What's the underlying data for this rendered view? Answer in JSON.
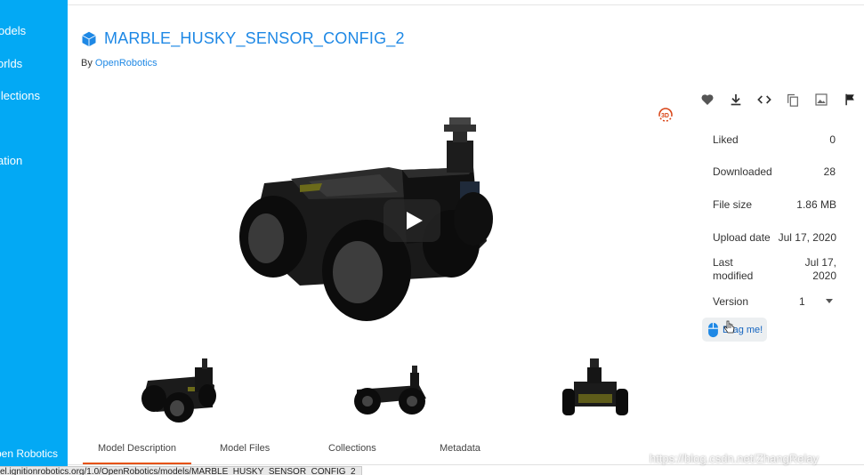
{
  "sidebar": {
    "items": [
      {
        "label": "odels"
      },
      {
        "label": "orlds"
      },
      {
        "label": "llections"
      },
      {
        "label": "ation"
      }
    ],
    "footer": "pen Robotics"
  },
  "model": {
    "title": "MARBLE_HUSKY_SENSOR_CONFIG_2",
    "by_prefix": "By ",
    "owner": "OpenRobotics"
  },
  "actions": [
    {
      "icon": "heart-icon"
    },
    {
      "icon": "download-icon"
    },
    {
      "icon": "code-icon"
    },
    {
      "icon": "copy-icon"
    },
    {
      "icon": "image-icon"
    },
    {
      "icon": "flag-icon"
    }
  ],
  "info": {
    "liked_label": "Liked",
    "liked_value": "0",
    "downloaded_label": "Downloaded",
    "downloaded_value": "28",
    "filesize_label": "File size",
    "filesize_value": "1.86 MB",
    "upload_label": "Upload date",
    "upload_value": "Jul 17, 2020",
    "modified_label_1": "Last",
    "modified_label_2": "modified",
    "modified_value_1": "Jul 17,",
    "modified_value_2": "2020",
    "version_label": "Version",
    "version_value": "1"
  },
  "drag_button": {
    "label": "Drag me!"
  },
  "tabs": [
    {
      "label": "Model Description"
    },
    {
      "label": "Model Files"
    },
    {
      "label": "Collections"
    },
    {
      "label": "Metadata"
    }
  ],
  "status_url": "el.ignitionrobotics.org/1.0/OpenRobotics/models/MARBLE_HUSKY_SENSOR_CONFIG_2",
  "watermark": "https://blog.csdn.net/ZhangRelay",
  "colors": {
    "sidebar": "#03a9f4",
    "accent": "#1e88e5",
    "tab_active": "#e65100"
  }
}
